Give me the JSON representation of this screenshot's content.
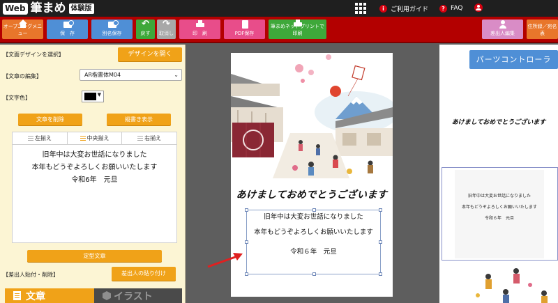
{
  "app": {
    "logo_web": "Web",
    "logo_name": "筆まめ",
    "logo_trial": "体験版",
    "guide_label": "ご利用ガイド",
    "faq_label": "FAQ"
  },
  "toolbar": {
    "opening_menu": "オープニングメニュー",
    "save": "保　存",
    "save_as": "別名保存",
    "undo": "戻す",
    "redo": "取消し",
    "print": "印　刷",
    "pdf_save": "PDF保存",
    "net_print": "筆まめネットプリントで印刷",
    "sender_edit": "差出人編集",
    "address_switch": "住所録／宛名表"
  },
  "left_panel": {
    "design_label": "【文面デザインを選択】",
    "design_button": "デザインを開く",
    "text_edit_label": "【文章の編集】",
    "font_value": "AR楷書体M04",
    "text_color_label": "【文字色】",
    "text_color": "#000000",
    "delete_text_button": "文章を削除",
    "vertical_button": "縦書き表示",
    "align_left": "左揃え",
    "align_center": "中央揃え",
    "align_right": "右揃え",
    "text_lines": [
      "旧年中は大変お世話になりました",
      "本年もどうぞよろしくお願いいたします",
      "令和6年　元旦"
    ],
    "template_button": "定型文章",
    "sender_label": "【差出人貼付・削除】",
    "sender_paste_button": "差出人の貼り付け",
    "tab_text": "文章",
    "tab_illust": "イラスト"
  },
  "card": {
    "greeting": "あけましておめでとうございます",
    "line1": "旧年中は大変お世話になりました",
    "line2": "本年もどうぞよろしくお願いいたします",
    "line3": "令和６年　元旦"
  },
  "right_panel": {
    "parts_controller": "パーツコントローラ",
    "greeting": "あけましておめでとうございます",
    "line1": "旧年中は大変お世話になりました",
    "line2": "本年もどうぞよろしくお願いいたします",
    "line3": "令和６年　元旦"
  },
  "colors": {
    "toolbar_red": "#b30000",
    "accent_orange": "#f0a218",
    "parts_blue": "#4f8fd6"
  }
}
